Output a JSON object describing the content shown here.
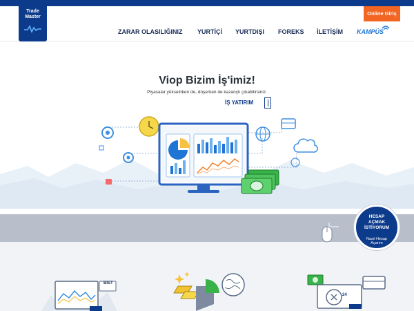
{
  "brand": {
    "line1": "Trade",
    "line2": "Master"
  },
  "header": {
    "online_label": "Online Giriş"
  },
  "nav": {
    "items": [
      {
        "label": "ZARAR OLASILIĞINIZ"
      },
      {
        "label": "YURTİÇİ"
      },
      {
        "label": "YURTDIŞI"
      },
      {
        "label": "FOREKS"
      },
      {
        "label": "İLETİŞİM"
      },
      {
        "label": "KAMPÜS"
      }
    ]
  },
  "hero": {
    "title": "Viop Bizim İş'imiz!",
    "subtitle": "Piyasalar yükselirken de, düşerken de kazançlı çıkabilirsiniz.",
    "partner": "İŞ YATIRIM",
    "slides": {
      "count": 3,
      "active": 1
    }
  },
  "cta": {
    "line1": "HESAP",
    "line2": "AÇMAK",
    "line3": "İSTİYORUM",
    "sub1": "Nasıl Hesap",
    "sub2": "Açarım"
  },
  "features": {
    "bist_label": "BIST",
    "fx_label": "24"
  },
  "colors": {
    "brand_blue": "#0d3b8c",
    "accent_orange": "#f26522",
    "link_blue": "#1f75d4"
  }
}
